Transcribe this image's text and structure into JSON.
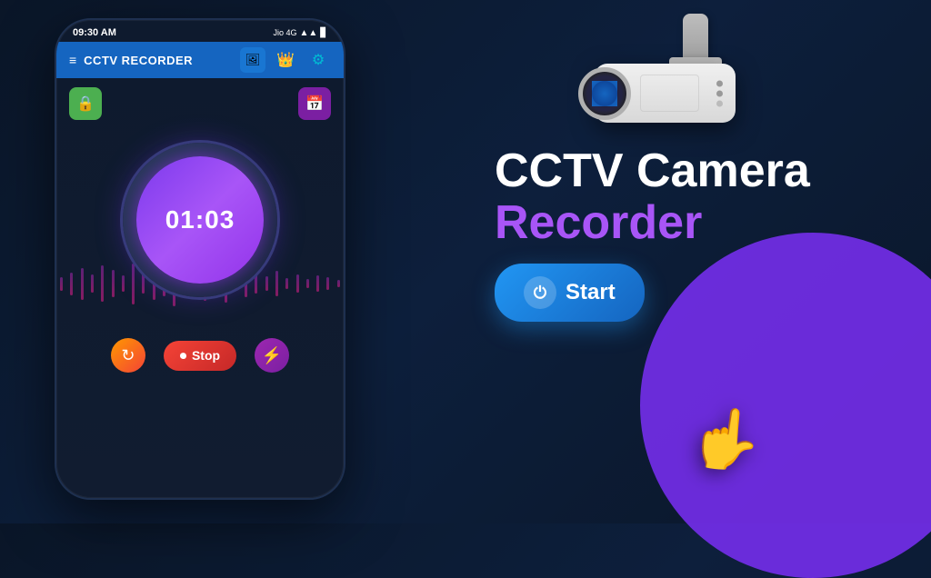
{
  "app": {
    "title": "CCTV RECORDER",
    "status_bar": {
      "time": "09:30 AM",
      "carrier": "Jio 4G",
      "signal": "▲▲",
      "battery": "🔋"
    }
  },
  "main_page": {
    "title_line1": "CCTV Camera",
    "title_line2": "Recorder",
    "start_button_label": "Start",
    "stop_button_label": "Stop",
    "timer_display": "01:03"
  },
  "icons": {
    "hamburger": "≡",
    "gallery": "🖼",
    "crown": "👑",
    "settings": "⚙",
    "camera_lock": "📷",
    "calendar": "📅",
    "power": "⏻",
    "refresh": "↻",
    "stop_record": "⏺",
    "lightning": "⚡"
  },
  "colors": {
    "primary_blue": "#1565c0",
    "purple_accent": "#a855f7",
    "stop_red": "#f44336",
    "start_blue": "#2196f3",
    "background_dark": "#0a1628",
    "blob_purple": "#7b2ff7"
  }
}
